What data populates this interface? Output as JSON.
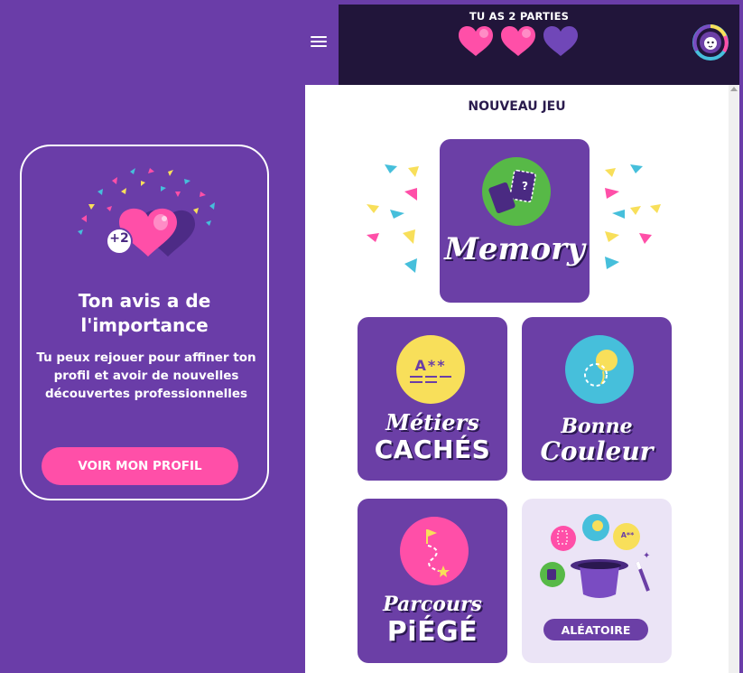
{
  "header": {
    "lives_text": "TU AS 2 PARTIES",
    "hearts": [
      {
        "name": "heart-full-1-icon",
        "state": "full"
      },
      {
        "name": "heart-full-2-icon",
        "state": "full"
      },
      {
        "name": "heart-empty-icon",
        "state": "used"
      }
    ],
    "avatar_icon": "lion-avatar-icon"
  },
  "menu": {
    "icon": "hamburger-menu-icon"
  },
  "promo": {
    "badge": "+2",
    "title": "Ton avis a de l'importance",
    "text": "Tu peux rejouer pour affiner ton profil et avoir de nouvelles découvertes professionnelles",
    "button_label": "VOIR MON PROFIL"
  },
  "games": {
    "section_title": "NOUVEAU JEU",
    "memory": {
      "title": "Memory",
      "icon": "cards-icon"
    },
    "metiers": {
      "line1": "Métiers",
      "line2": "CACHÉS",
      "icon_text": "A**"
    },
    "couleur": {
      "line1": "Bonne",
      "line2": "Couleur",
      "icon": "color-drop-icon"
    },
    "parcours": {
      "line1": "Parcours",
      "line2": "PiÉGÉ",
      "icon": "path-flag-icon"
    },
    "random": {
      "button_label": "ALÉATOIRE",
      "icon": "magic-hat-icon",
      "bubble_text": "A**"
    }
  },
  "colors": {
    "background": "#6a3da8",
    "topbar": "#21153a",
    "tile": "#6b3fa6",
    "pink": "#ff4fa8",
    "green": "#57b947",
    "yellow": "#f8df5a",
    "cyan": "#46bfdb"
  }
}
